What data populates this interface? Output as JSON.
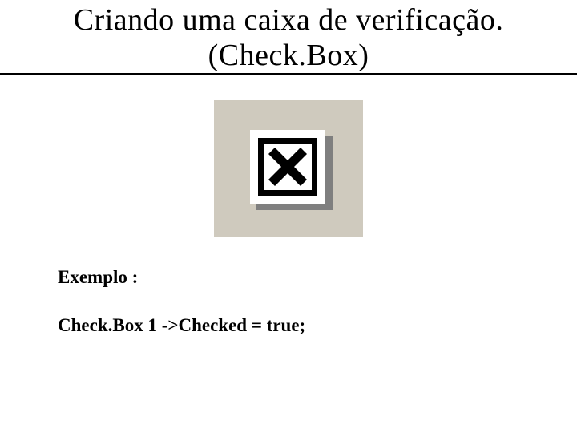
{
  "title": {
    "line1": "Criando uma caixa de verificação.",
    "line2": "(Check.Box)"
  },
  "icon": {
    "name": "checkbox-checked-icon",
    "background_color": "#cfcabe",
    "shadow_color": "#7f7f7f"
  },
  "example": {
    "label": "Exemplo :",
    "code": "Check.Box 1 ->Checked = true;"
  }
}
